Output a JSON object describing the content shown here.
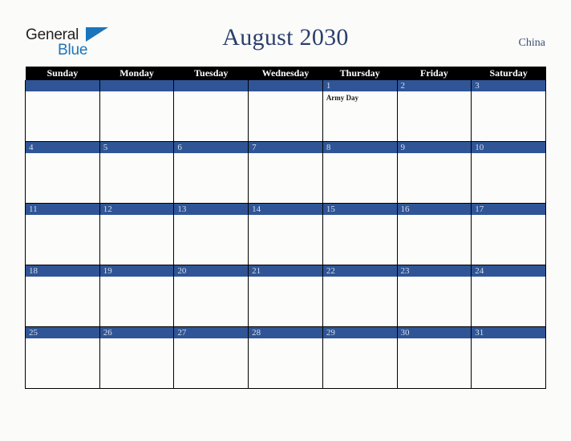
{
  "logo": {
    "word_one": "General",
    "word_two": "Blue",
    "triangle_icon": "triangle-icon",
    "brand_blue": "#1b75bc",
    "brand_dark": "#231f20"
  },
  "header": {
    "title": "August 2030",
    "country": "China",
    "title_color": "#2b3f6c"
  },
  "calendar": {
    "accent_blue": "#2f5597",
    "header_background": "#000000",
    "weekday_headers": [
      "Sunday",
      "Monday",
      "Tuesday",
      "Wednesday",
      "Thursday",
      "Friday",
      "Saturday"
    ],
    "weeks": [
      [
        {
          "day": "",
          "events": []
        },
        {
          "day": "",
          "events": []
        },
        {
          "day": "",
          "events": []
        },
        {
          "day": "",
          "events": []
        },
        {
          "day": "1",
          "events": [
            "Army Day"
          ]
        },
        {
          "day": "2",
          "events": []
        },
        {
          "day": "3",
          "events": []
        }
      ],
      [
        {
          "day": "4",
          "events": []
        },
        {
          "day": "5",
          "events": []
        },
        {
          "day": "6",
          "events": []
        },
        {
          "day": "7",
          "events": []
        },
        {
          "day": "8",
          "events": []
        },
        {
          "day": "9",
          "events": []
        },
        {
          "day": "10",
          "events": []
        }
      ],
      [
        {
          "day": "11",
          "events": []
        },
        {
          "day": "12",
          "events": []
        },
        {
          "day": "13",
          "events": []
        },
        {
          "day": "14",
          "events": []
        },
        {
          "day": "15",
          "events": []
        },
        {
          "day": "16",
          "events": []
        },
        {
          "day": "17",
          "events": []
        }
      ],
      [
        {
          "day": "18",
          "events": []
        },
        {
          "day": "19",
          "events": []
        },
        {
          "day": "20",
          "events": []
        },
        {
          "day": "21",
          "events": []
        },
        {
          "day": "22",
          "events": []
        },
        {
          "day": "23",
          "events": []
        },
        {
          "day": "24",
          "events": []
        }
      ],
      [
        {
          "day": "25",
          "events": []
        },
        {
          "day": "26",
          "events": []
        },
        {
          "day": "27",
          "events": []
        },
        {
          "day": "28",
          "events": []
        },
        {
          "day": "29",
          "events": []
        },
        {
          "day": "30",
          "events": []
        },
        {
          "day": "31",
          "events": []
        }
      ]
    ]
  }
}
